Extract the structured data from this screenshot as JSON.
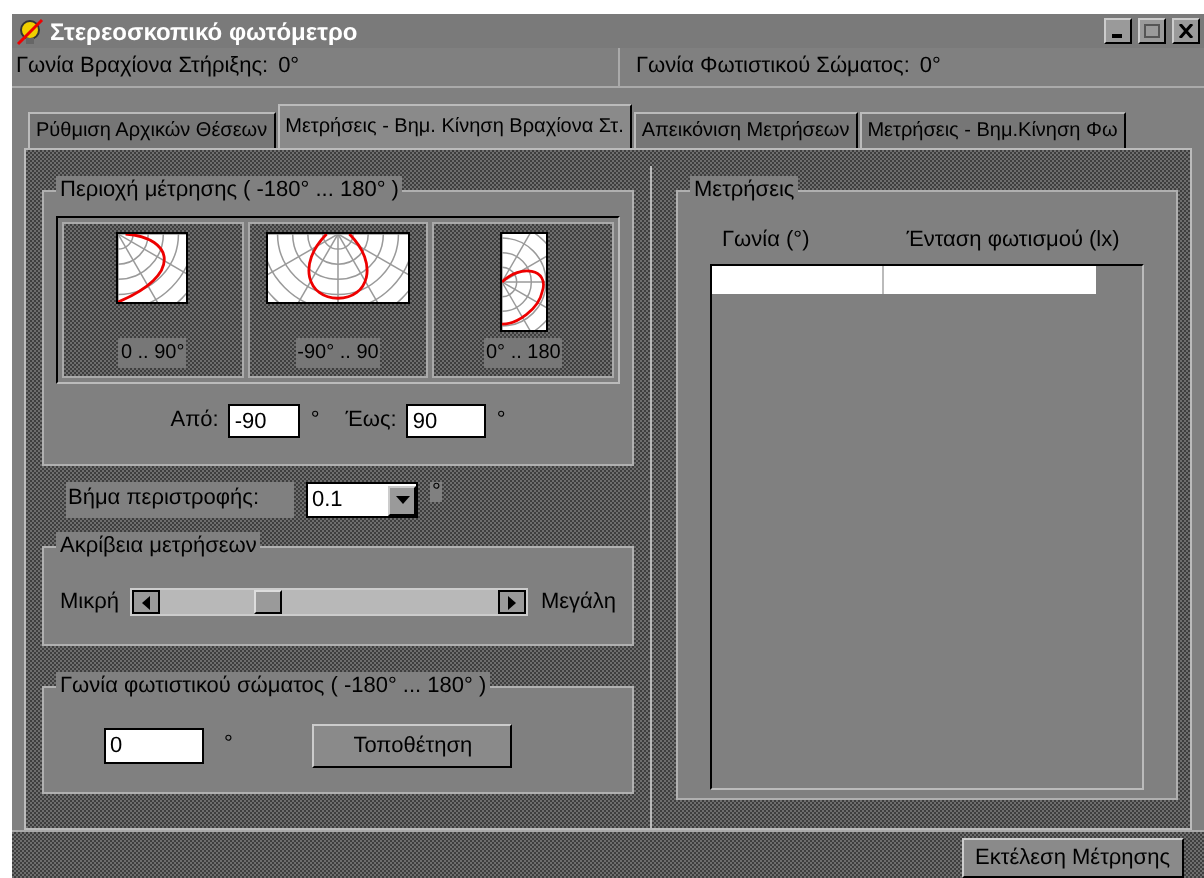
{
  "window": {
    "title": "Στερεοσκοπικό φωτόμετρο"
  },
  "status": [
    {
      "label": "Γωνία Βραχίονα Στήριξης:",
      "value": "0°"
    },
    {
      "label": "Γωνία Φωτιστικού Σώματος:",
      "value": "0°"
    }
  ],
  "tabs": [
    {
      "label": "Ρύθμιση Αρχικών Θέσεων",
      "selected": false
    },
    {
      "label": "Μετρήσεις - Βημ. Κίνηση Βραχίονα Στ.",
      "selected": true
    },
    {
      "label": "Απεικόνιση Μετρήσεων",
      "selected": false
    },
    {
      "label": "Μετρήσεις - Βημ.Κίνηση Φω",
      "selected": false
    }
  ],
  "range": {
    "title": "Περιοχή μέτρησης ( -180° ... 180° )",
    "presets": [
      {
        "kind": "quarter",
        "caption": "0 .. 90°"
      },
      {
        "kind": "front",
        "caption": "-90° .. 90"
      },
      {
        "kind": "side",
        "caption": "0° .. 180"
      }
    ],
    "from": {
      "label": "Από:",
      "value": "-90",
      "unit": "°"
    },
    "to": {
      "label": "Έως:",
      "value": "90",
      "unit": "°"
    }
  },
  "step": {
    "label": "Βήμα περιστροφής:",
    "value": "0.1",
    "unit": "°"
  },
  "precision": {
    "title": "Ακρίβεια μετρήσεων",
    "min_label": "Μικρή",
    "max_label": "Μεγάλη",
    "level": 0.3
  },
  "lamp": {
    "title": "Γωνία φωτιστικού σώματος ( -180° ... 180° )",
    "value": "0",
    "unit": "°",
    "button": "Τοποθέτηση"
  },
  "measurements": {
    "title": "Μετρήσεις",
    "columns": [
      "Γωνία (°)",
      "Ένταση φωτισμού (lx)"
    ]
  },
  "run_button": "Εκτέλεση Μέτρησης"
}
